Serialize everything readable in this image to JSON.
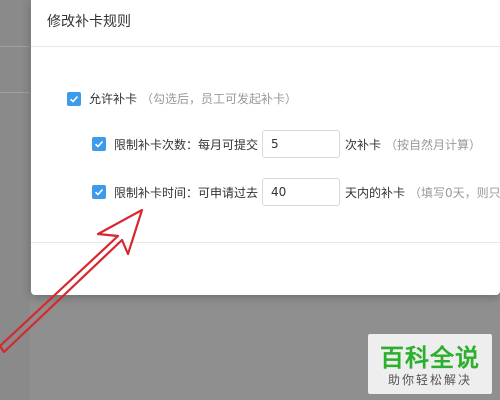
{
  "modal": {
    "title": "修改补卡规则",
    "allow": {
      "checked": true,
      "label": "允许补卡",
      "hint": "（勾选后，员工可发起补卡）"
    },
    "limit_count": {
      "checked": true,
      "label": "限制补卡次数：",
      "prefix": "每月可提交",
      "value": "5",
      "unit": "次补卡",
      "hint": "（按自然月计算）"
    },
    "limit_time": {
      "checked": true,
      "label": "限制补卡时间：",
      "prefix": "可申请过去",
      "value": "40",
      "unit": "天内的补卡",
      "hint": "（填写0天，则只"
    }
  },
  "watermark": {
    "title": "百科全说",
    "subtitle": "助你轻松解决"
  },
  "colors": {
    "checkbox": "#3d9be9",
    "arrow": "#d6282e",
    "watermark_green": "#2cb02c"
  }
}
